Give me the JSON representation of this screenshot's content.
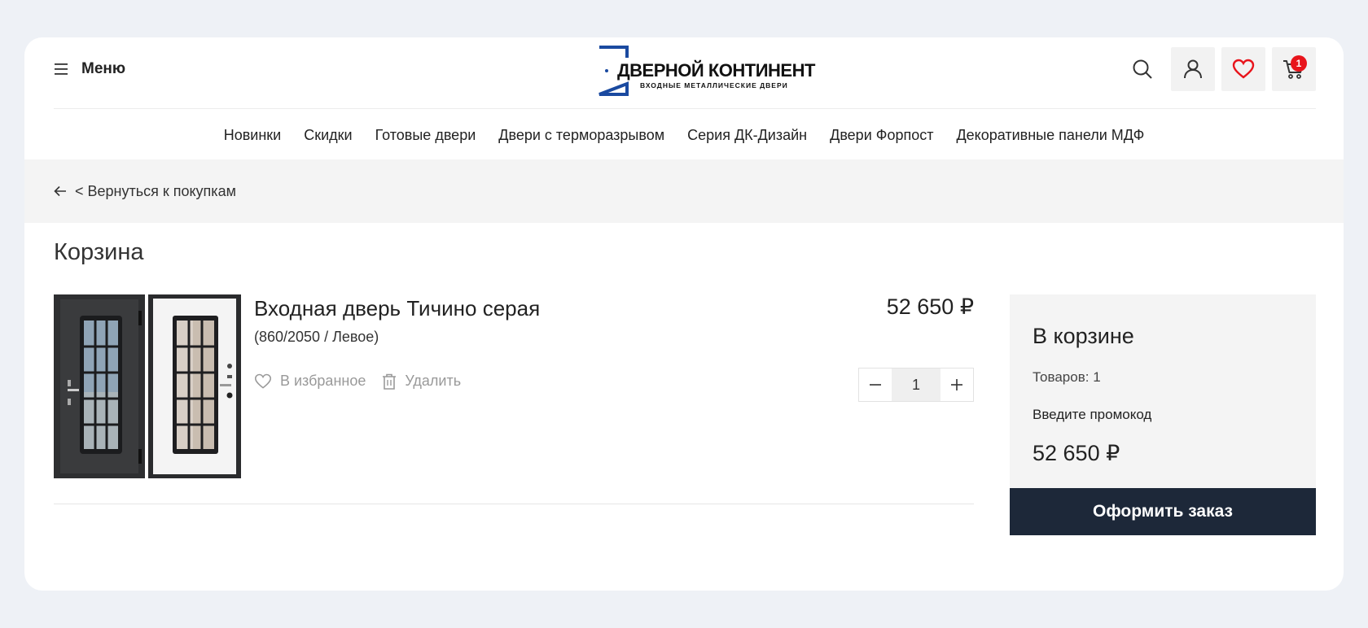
{
  "header": {
    "menu_label": "Меню",
    "logo": {
      "title": "ДВЕРНОЙ КОНТИНЕНТ",
      "subtitle": "ВХОДНЫЕ МЕТАЛЛИЧЕСКИЕ ДВЕРИ"
    },
    "icons": [
      "search-icon",
      "user-icon",
      "heart-icon",
      "cart-icon"
    ],
    "cart_badge": "1"
  },
  "nav": {
    "items": [
      "Новинки",
      "Скидки",
      "Готовые двери",
      "Двери с терморазрывом",
      "Серия ДК-Дизайн",
      "Двери Форпост",
      "Декоративные панели МДФ"
    ]
  },
  "back_link": "< Вернуться к покупкам",
  "page_title": "Корзина",
  "cart_item": {
    "name": "Входная дверь Тичино серая",
    "variant": "(860/2050 / Левое)",
    "price": "52 650 ₽",
    "favorite_label": "В избранное",
    "delete_label": "Удалить",
    "quantity": "1"
  },
  "summary": {
    "title": "В корзине",
    "items_count": "Товаров: 1",
    "promo_label": "Введите промокод",
    "total": "52 650 ₽",
    "checkout_label": "Оформить заказ"
  },
  "colors": {
    "accent": "#e8141b",
    "checkout_bg": "#1d2839",
    "logo_blue": "#1a4aa0"
  }
}
